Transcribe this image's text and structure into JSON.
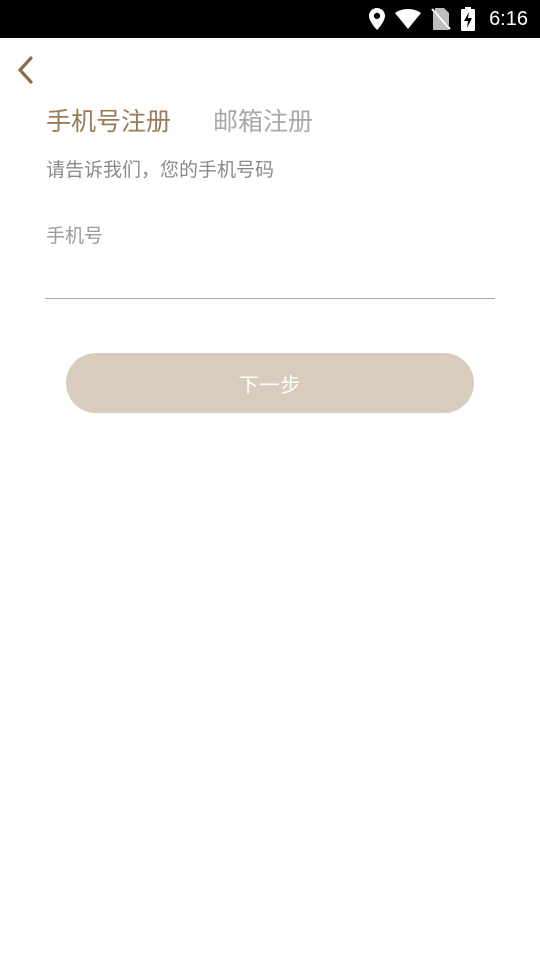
{
  "status_bar": {
    "time": "6:16",
    "icons": [
      "location-icon",
      "wifi-icon",
      "no-sim-icon",
      "battery-charging-icon"
    ]
  },
  "header": {
    "back_icon": "chevron-left-icon"
  },
  "tabs": [
    {
      "label": "手机号注册",
      "active": true
    },
    {
      "label": "邮箱注册",
      "active": false
    }
  ],
  "form": {
    "subtitle": "请告诉我们，您的手机号码",
    "phone_label": "手机号",
    "phone_value": "",
    "next_button": "下一步"
  },
  "colors": {
    "accent": "#9a7b57",
    "button_bg": "#d9cbbe",
    "inactive_tab": "#a8a8a8"
  }
}
